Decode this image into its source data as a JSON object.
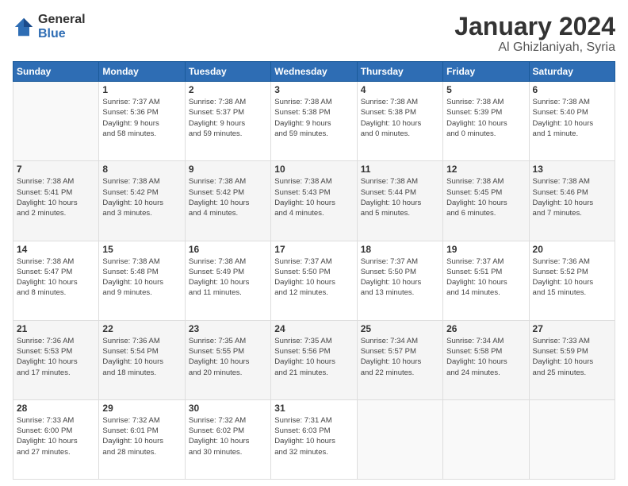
{
  "logo": {
    "line1": "General",
    "line2": "Blue"
  },
  "title": "January 2024",
  "subtitle": "Al Ghizlaniyah, Syria",
  "days_of_week": [
    "Sunday",
    "Monday",
    "Tuesday",
    "Wednesday",
    "Thursday",
    "Friday",
    "Saturday"
  ],
  "weeks": [
    [
      {
        "day": "",
        "info": ""
      },
      {
        "day": "1",
        "info": "Sunrise: 7:37 AM\nSunset: 5:36 PM\nDaylight: 9 hours\nand 58 minutes."
      },
      {
        "day": "2",
        "info": "Sunrise: 7:38 AM\nSunset: 5:37 PM\nDaylight: 9 hours\nand 59 minutes."
      },
      {
        "day": "3",
        "info": "Sunrise: 7:38 AM\nSunset: 5:38 PM\nDaylight: 9 hours\nand 59 minutes."
      },
      {
        "day": "4",
        "info": "Sunrise: 7:38 AM\nSunset: 5:38 PM\nDaylight: 10 hours\nand 0 minutes."
      },
      {
        "day": "5",
        "info": "Sunrise: 7:38 AM\nSunset: 5:39 PM\nDaylight: 10 hours\nand 0 minutes."
      },
      {
        "day": "6",
        "info": "Sunrise: 7:38 AM\nSunset: 5:40 PM\nDaylight: 10 hours\nand 1 minute."
      }
    ],
    [
      {
        "day": "7",
        "info": "Sunrise: 7:38 AM\nSunset: 5:41 PM\nDaylight: 10 hours\nand 2 minutes."
      },
      {
        "day": "8",
        "info": "Sunrise: 7:38 AM\nSunset: 5:42 PM\nDaylight: 10 hours\nand 3 minutes."
      },
      {
        "day": "9",
        "info": "Sunrise: 7:38 AM\nSunset: 5:42 PM\nDaylight: 10 hours\nand 4 minutes."
      },
      {
        "day": "10",
        "info": "Sunrise: 7:38 AM\nSunset: 5:43 PM\nDaylight: 10 hours\nand 4 minutes."
      },
      {
        "day": "11",
        "info": "Sunrise: 7:38 AM\nSunset: 5:44 PM\nDaylight: 10 hours\nand 5 minutes."
      },
      {
        "day": "12",
        "info": "Sunrise: 7:38 AM\nSunset: 5:45 PM\nDaylight: 10 hours\nand 6 minutes."
      },
      {
        "day": "13",
        "info": "Sunrise: 7:38 AM\nSunset: 5:46 PM\nDaylight: 10 hours\nand 7 minutes."
      }
    ],
    [
      {
        "day": "14",
        "info": "Sunrise: 7:38 AM\nSunset: 5:47 PM\nDaylight: 10 hours\nand 8 minutes."
      },
      {
        "day": "15",
        "info": "Sunrise: 7:38 AM\nSunset: 5:48 PM\nDaylight: 10 hours\nand 9 minutes."
      },
      {
        "day": "16",
        "info": "Sunrise: 7:38 AM\nSunset: 5:49 PM\nDaylight: 10 hours\nand 11 minutes."
      },
      {
        "day": "17",
        "info": "Sunrise: 7:37 AM\nSunset: 5:50 PM\nDaylight: 10 hours\nand 12 minutes."
      },
      {
        "day": "18",
        "info": "Sunrise: 7:37 AM\nSunset: 5:50 PM\nDaylight: 10 hours\nand 13 minutes."
      },
      {
        "day": "19",
        "info": "Sunrise: 7:37 AM\nSunset: 5:51 PM\nDaylight: 10 hours\nand 14 minutes."
      },
      {
        "day": "20",
        "info": "Sunrise: 7:36 AM\nSunset: 5:52 PM\nDaylight: 10 hours\nand 15 minutes."
      }
    ],
    [
      {
        "day": "21",
        "info": "Sunrise: 7:36 AM\nSunset: 5:53 PM\nDaylight: 10 hours\nand 17 minutes."
      },
      {
        "day": "22",
        "info": "Sunrise: 7:36 AM\nSunset: 5:54 PM\nDaylight: 10 hours\nand 18 minutes."
      },
      {
        "day": "23",
        "info": "Sunrise: 7:35 AM\nSunset: 5:55 PM\nDaylight: 10 hours\nand 20 minutes."
      },
      {
        "day": "24",
        "info": "Sunrise: 7:35 AM\nSunset: 5:56 PM\nDaylight: 10 hours\nand 21 minutes."
      },
      {
        "day": "25",
        "info": "Sunrise: 7:34 AM\nSunset: 5:57 PM\nDaylight: 10 hours\nand 22 minutes."
      },
      {
        "day": "26",
        "info": "Sunrise: 7:34 AM\nSunset: 5:58 PM\nDaylight: 10 hours\nand 24 minutes."
      },
      {
        "day": "27",
        "info": "Sunrise: 7:33 AM\nSunset: 5:59 PM\nDaylight: 10 hours\nand 25 minutes."
      }
    ],
    [
      {
        "day": "28",
        "info": "Sunrise: 7:33 AM\nSunset: 6:00 PM\nDaylight: 10 hours\nand 27 minutes."
      },
      {
        "day": "29",
        "info": "Sunrise: 7:32 AM\nSunset: 6:01 PM\nDaylight: 10 hours\nand 28 minutes."
      },
      {
        "day": "30",
        "info": "Sunrise: 7:32 AM\nSunset: 6:02 PM\nDaylight: 10 hours\nand 30 minutes."
      },
      {
        "day": "31",
        "info": "Sunrise: 7:31 AM\nSunset: 6:03 PM\nDaylight: 10 hours\nand 32 minutes."
      },
      {
        "day": "",
        "info": ""
      },
      {
        "day": "",
        "info": ""
      },
      {
        "day": "",
        "info": ""
      }
    ]
  ]
}
